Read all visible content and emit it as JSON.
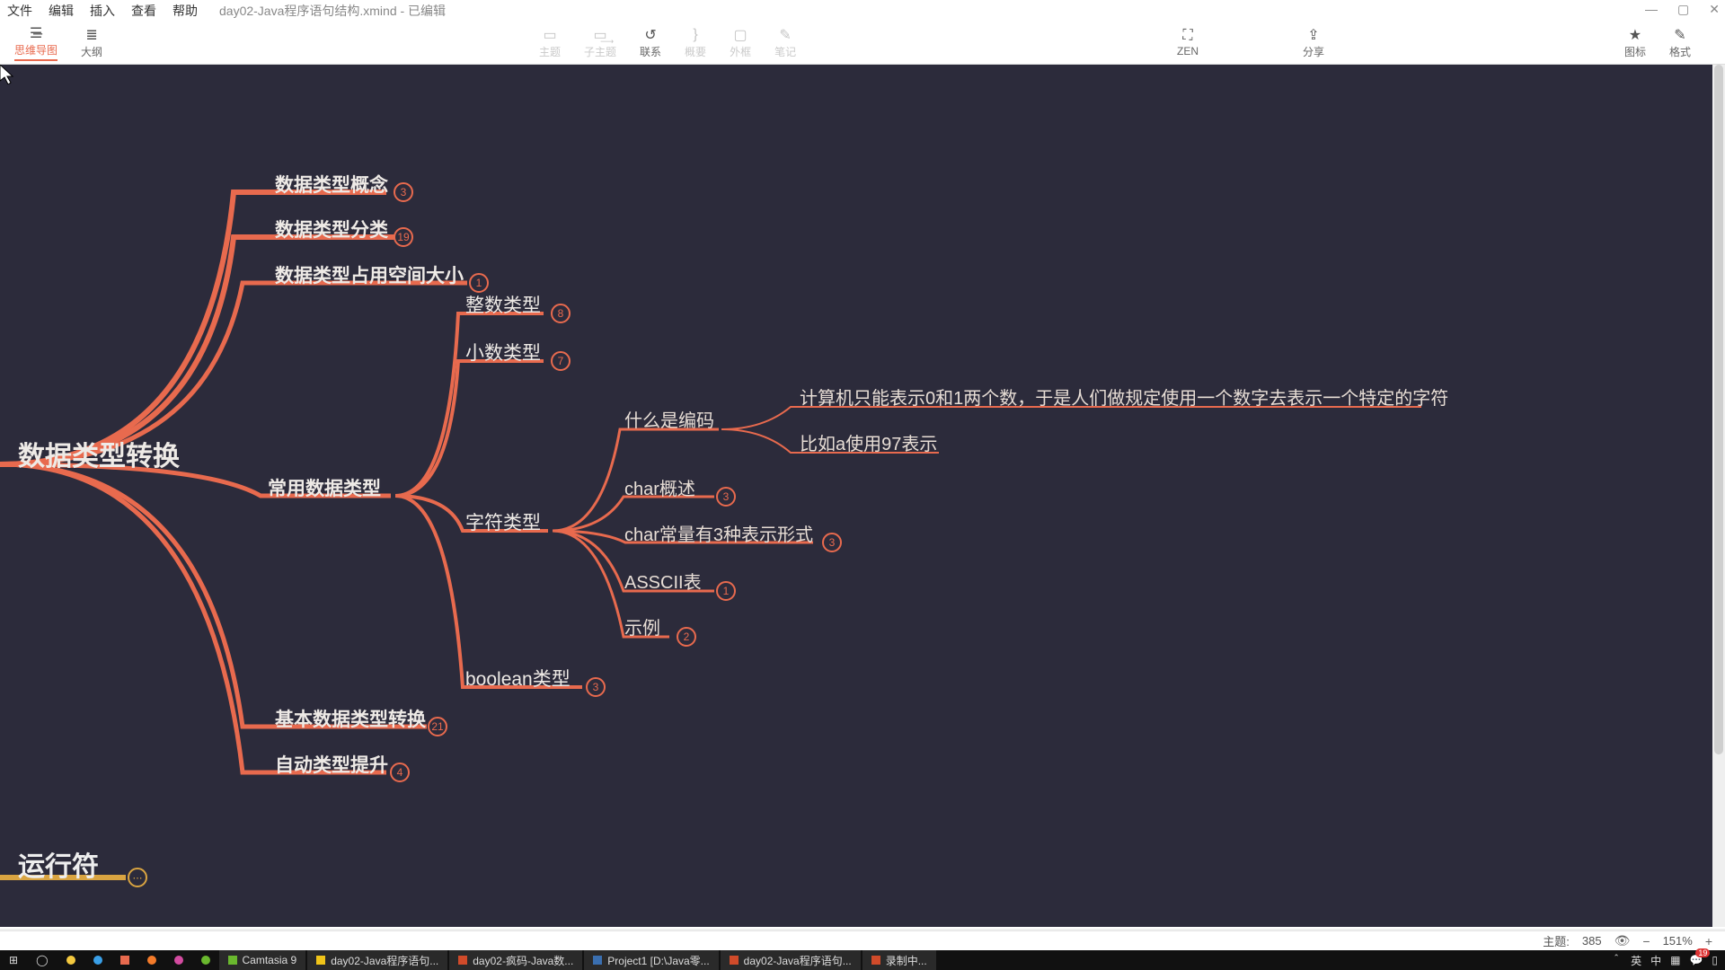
{
  "menu": {
    "file": "文件",
    "edit": "编辑",
    "insert": "插入",
    "view": "查看",
    "help": "帮助",
    "doc": "day02-Java程序语句结构.xmind - 已编辑"
  },
  "win": {
    "min": "—",
    "max": "▢",
    "close": "✕"
  },
  "toolbar": {
    "mindmap": "思维导图",
    "outline": "大纲",
    "topic": "主题",
    "subtopic": "子主题",
    "relation": "联系",
    "summary": "概要",
    "frame": "外框",
    "note": "笔记",
    "zen": "ZEN",
    "share": "分享",
    "iconlib": "图标",
    "format": "格式"
  },
  "root": "数据类型转换",
  "root2": "运行符",
  "branches": [
    {
      "label": "数据类型概念",
      "badge": "3"
    },
    {
      "label": "数据类型分类",
      "badge": "19"
    },
    {
      "label": "数据类型占用空间大小",
      "badge": "1"
    },
    {
      "label": "常用数据类型"
    },
    {
      "label": "基本数据类型转换",
      "badge": "21"
    },
    {
      "label": "自动类型提升",
      "badge": "4"
    }
  ],
  "types": [
    {
      "label": "整数类型",
      "badge": "8"
    },
    {
      "label": "小数类型",
      "badge": "7"
    },
    {
      "label": "字符类型"
    },
    {
      "label": "boolean类型",
      "badge": "3"
    }
  ],
  "char": [
    {
      "label": "什么是编码"
    },
    {
      "label": "char概述",
      "badge": "3"
    },
    {
      "label": "char常量有3种表示形式",
      "badge": "3"
    },
    {
      "label": "ASSCII表",
      "badge": "1"
    },
    {
      "label": "示例",
      "badge": "2"
    }
  ],
  "encoding": [
    "计算机只能表示0和1两个数，于是人们做规定使用一个数字去表示一个特定的字符",
    "比如a使用97表示"
  ],
  "status": {
    "topics_lbl": "主题:",
    "topics": "385",
    "zoom": "151%"
  },
  "taskbar": {
    "apps": [
      {
        "color": "#f0c419",
        "label": "Camtasia 9"
      },
      {
        "color": "#f0c419",
        "label": "day02-Java程序语句..."
      },
      {
        "color": "#d14b2a",
        "label": "day02-疯码-Java数..."
      },
      {
        "color": "#3a6fb0",
        "label": "Project1 [D:\\Java零..."
      },
      {
        "color": "#d14b2a",
        "label": "day02-Java程序语句..."
      },
      {
        "color": "#d14b2a",
        "label": "录制中..."
      }
    ],
    "tray": {
      "ime1": "英",
      "ime2": "中",
      "badge": "19"
    }
  }
}
